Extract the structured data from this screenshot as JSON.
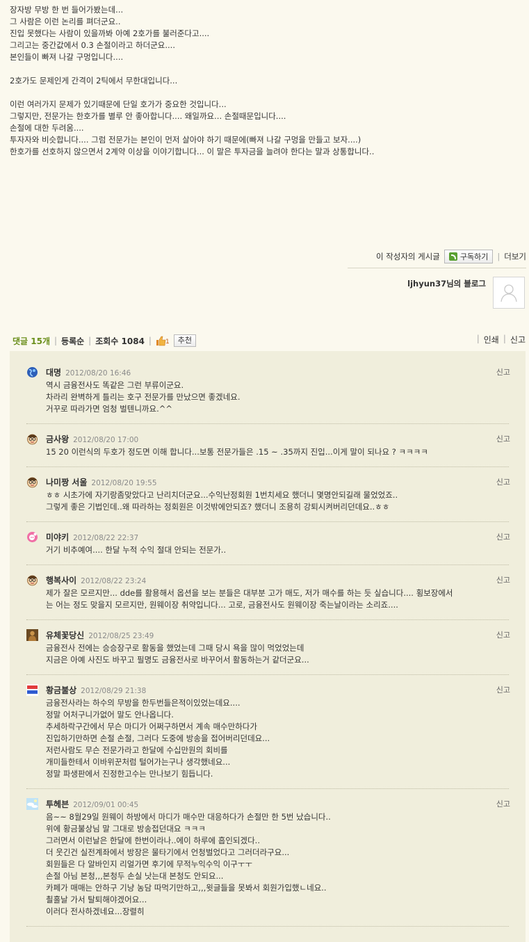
{
  "post": {
    "paragraphs": [
      [
        "장자방 무방 한 번 들어가봤는데...",
        "그 사람은 이런 논리를 펴더군요..",
        "진입 못했다는 사람이 있을까봐 아예 2호가를 불러준다고....",
        "그리고는 중간값에서 0.3 손절이라고 하더군요....",
        "본인들이 빠져 나갈 구멍입니다...."
      ],
      [
        "2호가도 문제인게 간격이 2틱에서 무한대입니다..."
      ],
      [
        "이런 여러가지 문제가 있기때문에 단일 호가가 중요한 것입니다...",
        "그렇지만, 전문가는 한호가를 별루 안 좋아합니다.... 왜일까요... 손절때문입니다....",
        "손절에 대한 두려움....",
        "투자자와 비슷합니다.... 그럼 전문가는 본인이 먼저 살아야 하기 때문에(빠져 나갈 구멍을 만들고 보자....)",
        "한호가를 선호하지 않으면서 2계약 이상을 이야기합니다... 이 말은 투자금을 늘려야 한다는 말과 상통합니다.."
      ]
    ]
  },
  "author": {
    "posts_label": "이 작성자의 게시글",
    "subscribe_label": "구독하기",
    "more_label": "더보기",
    "blog_name": "ljhyun37님의 블로그"
  },
  "stats": {
    "comments_label": "댓글 15개",
    "order_label": "등록순",
    "views_label": "조회수 1084",
    "like_count": "1",
    "recommend_label": "추천",
    "print_label": "인쇄",
    "report_label": "신고"
  },
  "comments": [
    {
      "name": "대명",
      "date": "2012/08/20 16:46",
      "report": "신고",
      "icon": "globe-icon",
      "lines": [
        "역시 금융전사도 똑같은 그런 부류이군요.",
        "차라리 완벽하게 틀리는 호구 전문가를 만났으면 좋겠네요.",
        "거꾸로 따라가면 엄청 벌텐니까요.^^"
      ]
    },
    {
      "name": "금사왕",
      "date": "2012/08/20 17:00",
      "report": "신고",
      "icon": "glasses-face-icon",
      "lines": [
        "15 20 이런식의 두호가 정도면 이해 합니다...보통 전문가들은 .15 ~ .35까지 진입...이게 말이 되나요 ? ㅋㅋㅋㅋ"
      ]
    },
    {
      "name": "나미짱 서울",
      "date": "2012/08/20 19:55",
      "report": "신고",
      "icon": "glasses-face-icon",
      "lines": [
        "ㅎㅎ 시초가에 자기랑좀맞았다고 난리치더군요...수익난정회원 1번치세요 했더니 몇명안되길래 물었었죠..",
        "그렇게 좋은 기법인데..왜 따라하는 정회원은 이것밖에안되죠? 했더니 조용히 강퇴시켜버리던데요..ㅎㅎ"
      ]
    },
    {
      "name": "미야키",
      "date": "2012/08/22 22:37",
      "report": "신고",
      "icon": "pink-bubble-icon",
      "lines": [
        "거기 비추예여.... 한달 누적 수익 절대 안되는 전문가.."
      ]
    },
    {
      "name": "행복사이",
      "date": "2012/08/22 23:24",
      "report": "신고",
      "icon": "glasses-face-icon",
      "lines": [
        "제가 잘은 모르지만... dde를 활용해서 옵션을 보는 분들은 대부분 고가 매도, 저가 매수를 하는 듯 싶습니다.... 횡보장에서",
        "는 어는 정도 맞을지 모르지만, 원웨이장 취약입니다... 고로, 금융전사도 원웨이장 죽는날이라는 소리죠...."
      ]
    },
    {
      "name": "유체꽃당신",
      "date": "2012/08/25 23:49",
      "report": "신고",
      "icon": "statue-icon",
      "lines": [
        "금융전사 전에는 승승장구로 활동을 했었는데 그때 당시 욕을 많이 먹었었는데",
        "지금은 아예 사진도 바꾸고 필명도 금융전사로 바꾸어서 활동하는거 같더군요..."
      ]
    },
    {
      "name": "황금불상",
      "date": "2012/08/29 21:38",
      "report": "신고",
      "icon": "text-logo-icon",
      "lines": [
        "금융전사라는 하수의 무방을 한두번들은적이있었는데요....",
        "정말 어처구니가없어 말도 안나옵니다.",
        "추세하락구간에서 무슨 마디가 어쩌구하면서 계속 매수만하다가",
        "진입하기만하면 손절 손절, 그러다 도중에 방송을 접어버리던데요...",
        "저런사람도 무슨 전문가라고 한달에 수십만원의 회비를",
        "개미들한테서 이바위꾼처럼 털어가는구나 생각했네요...",
        "정말 파생판에서 진정한고수는 만나보기 힘듭니다."
      ]
    },
    {
      "name": "투헤븐",
      "date": "2012/09/01 00:45",
      "report": "신고",
      "icon": "sky-photo-icon",
      "lines": [
        "음~~ 8월29일 원웨이 하방에서 마디가 매수만 대응하다가 손절만 한 5번 났습니다..",
        "위에 황금불상님 말 그대로 방송접던대요 ㅋㅋㅋ",
        "그러면서 이런날은 한달에 한번이라나..에이 하루에 흡인되겠다..",
        "더 웃긴건 실전계좌에서 방장은 물타기에서 언청벌었다고 그러더라구요...",
        "회원들은 다 알바인지 리얼가면 후기에 무적누익수익 이구ㅜㅜ",
        "손절 아님 본청,,,본청두 손실 낫는대 본청도 안되요...",
        "카페가 매매는 안하구 기냥 농담 따먹기만하고,,,윗글들을 못봐서 회원가입했ㄴ네요..",
        "쵤홀날 가서 탈퇴해야겠어요...",
        "이러다 전사하겠네요...장렬히"
      ]
    }
  ]
}
